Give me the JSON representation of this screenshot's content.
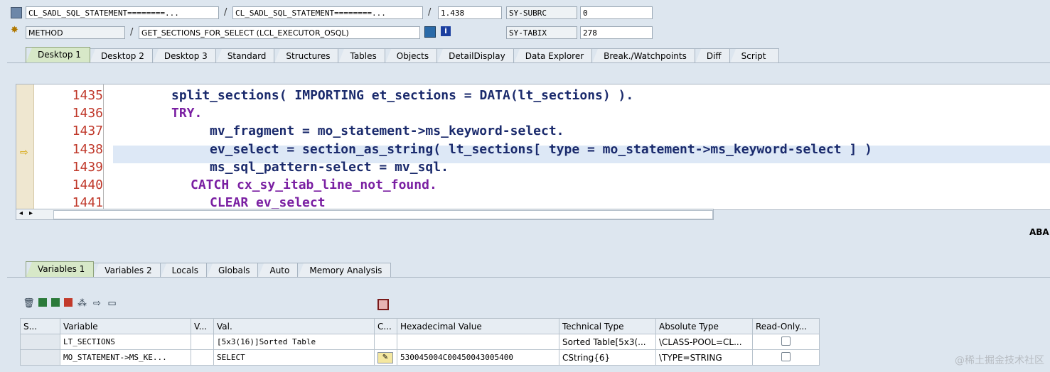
{
  "header": {
    "row1": {
      "program": "CL_SADL_SQL_STATEMENT========...",
      "include": "CL_SADL_SQL_STATEMENT========...",
      "line": "1.438",
      "sysvar": "SY-SUBRC",
      "sysval": "0"
    },
    "row2": {
      "type": "METHOD",
      "name": "GET_SECTIONS_FOR_SELECT (LCL_EXECUTOR_OSQL)",
      "sysvar": "SY-TABIX",
      "sysval": "278"
    }
  },
  "desktop_tabs": [
    "Desktop 1",
    "Desktop 2",
    "Desktop 3",
    "Standard",
    "Structures",
    "Tables",
    "Objects",
    "DetailDisplay",
    "Data Explorer",
    "Break./Watchpoints",
    "Diff",
    "Script"
  ],
  "code": {
    "line_numbers": [
      "1435",
      "1436",
      "1437",
      "1438",
      "1439",
      "1440",
      "1441"
    ],
    "lines": [
      "split_sections( IMPORTING et_sections = DATA(lt_sections) ).",
      "TRY.",
      "mv_fragment = mo_statement->ms_keyword-select.",
      "ev_select = section_as_string( lt_sections[ type = mo_statement->ms_keyword-select ] )",
      "ms_sql_pattern-select = mv_sql.",
      "CATCH cx_sy_itab_line_not_found.",
      "CLEAR ev_select"
    ],
    "current_line_marker": "⇨",
    "right_label": "ABA"
  },
  "variable_tabs": [
    "Variables 1",
    "Variables 2",
    "Locals",
    "Globals",
    "Auto",
    "Memory Analysis"
  ],
  "grid": {
    "columns": [
      "S...",
      "Variable",
      "V...",
      "Val.",
      "C...",
      "Hexadecimal Value",
      "Technical Type",
      "Absolute Type",
      "Read-Only..."
    ],
    "rows": [
      {
        "variable": "LT_SECTIONS",
        "val": "[5x3(16)]Sorted Table",
        "hex": "",
        "tech": "Sorted Table[5x3(...",
        "abs": "\\CLASS-POOL=CL..."
      },
      {
        "variable": "MO_STATEMENT->MS_KE...",
        "val": "SELECT",
        "hex": "530045004C00450043005400",
        "tech": "CString{6}",
        "abs": "\\TYPE=STRING"
      }
    ]
  },
  "watermark": "@稀土掘金技术社区"
}
